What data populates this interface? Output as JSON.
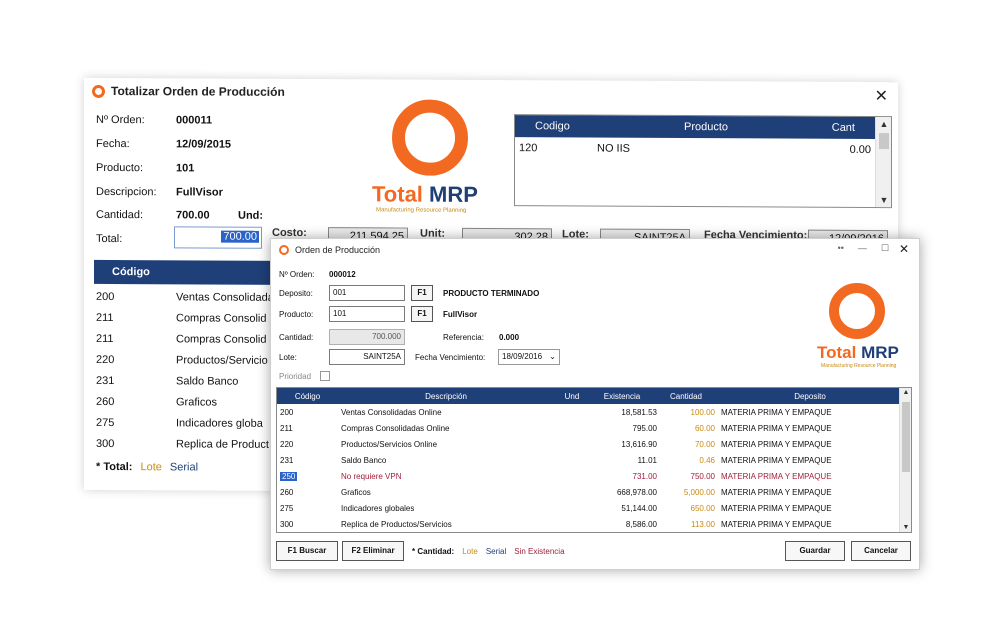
{
  "back_window": {
    "title": "Totalizar Orden de Producción",
    "close_glyph": "✕",
    "fields": {
      "orden_label": "Nº Orden:",
      "orden_value": "000011",
      "fecha_label": "Fecha:",
      "fecha_value": "12/09/2015",
      "producto_label": "Producto:",
      "producto_value": "101",
      "descripcion_label": "Descripcion:",
      "descripcion_value": "FullVisor",
      "cantidad_label": "Cantidad:",
      "cantidad_value": "700.00",
      "und_label": "Und:",
      "total_label": "Total:",
      "total_value": "700.00"
    },
    "strip": {
      "costo_label": "Costo:",
      "costo_value": "211,594.25",
      "unit_label": "Unit:",
      "unit_value": "302.28",
      "lote_label": "Lote:",
      "lote_value": "SAINT25A",
      "venc_label": "Fecha Vencimiento:",
      "venc_value": "12/09/2016"
    },
    "grid_header": {
      "codigo": "Código"
    },
    "rows": [
      {
        "code": "200",
        "desc": "Ventas Consolidadas"
      },
      {
        "code": "211",
        "desc": "Compras Consolid"
      },
      {
        "code": "211",
        "desc": "Compras Consolid"
      },
      {
        "code": "220",
        "desc": "Productos/Servicio"
      },
      {
        "code": "231",
        "desc": "Saldo Banco"
      },
      {
        "code": "260",
        "desc": "Graficos"
      },
      {
        "code": "275",
        "desc": "Indicadores globa"
      },
      {
        "code": "300",
        "desc": "Replica de Product"
      }
    ],
    "legend": {
      "label": "* Total:",
      "lote": "Lote",
      "serial": "Serial"
    },
    "mini_grid": {
      "headers": {
        "codigo": "Codigo",
        "producto": "Producto",
        "cant": "Cant"
      },
      "rows": [
        {
          "codigo": "120",
          "producto": "NO IIS",
          "cant": "0.00"
        }
      ]
    }
  },
  "logo": {
    "word1": "Total",
    "word2": " MRP",
    "tagline": "Manufacturing Resource Planning"
  },
  "front_window": {
    "title": "Orden de Producción",
    "close_glyph": "✕",
    "fields": {
      "orden_label": "Nº Orden:",
      "orden_value": "000012",
      "deposito_label": "Deposito:",
      "deposito_value": "001",
      "deposito_f1": "F1",
      "deposito_name": "PRODUCTO TERMINADO",
      "producto_label": "Producto:",
      "producto_value": "101",
      "producto_f1": "F1",
      "producto_name": "FullVisor",
      "cantidad_label": "Cantidad:",
      "cantidad_value": "700.000",
      "referencia_label": "Referencia:",
      "referencia_value": "0.000",
      "lote_label": "Lote:",
      "lote_value": "SAINT25A",
      "venc_label": "Fecha Vencimiento:",
      "venc_value": "18/09/2016",
      "prioridad_label": "Prioridad"
    },
    "grid_headers": {
      "codigo": "Código",
      "descripcion": "Descripción",
      "und": "Und",
      "existencia": "Existencia",
      "cantidad": "Cantidad",
      "deposito": "Deposito"
    },
    "rows": [
      {
        "code": "200",
        "desc": "Ventas Consolidadas Online",
        "exist": "18,581.53",
        "cant": "100.00",
        "dep": "MATERIA PRIMA Y EMPAQUE"
      },
      {
        "code": "211",
        "desc": "Compras Consolidadas Online",
        "exist": "795.00",
        "cant": "60.00",
        "dep": "MATERIA PRIMA Y EMPAQUE"
      },
      {
        "code": "220",
        "desc": "Productos/Servicios Online",
        "exist": "13,616.90",
        "cant": "70.00",
        "dep": "MATERIA PRIMA Y EMPAQUE"
      },
      {
        "code": "231",
        "desc": "Saldo Banco",
        "exist": "11.01",
        "cant": "0.46",
        "dep": "MATERIA PRIMA Y EMPAQUE"
      },
      {
        "code": "250",
        "desc": "No requiere VPN",
        "exist": "731.00",
        "cant": "750.00",
        "dep": "MATERIA PRIMA Y EMPAQUE"
      },
      {
        "code": "260",
        "desc": "Graficos",
        "exist": "668,978.00",
        "cant": "5,000.00",
        "dep": "MATERIA PRIMA Y EMPAQUE"
      },
      {
        "code": "275",
        "desc": "Indicadores globales",
        "exist": "51,144.00",
        "cant": "650.00",
        "dep": "MATERIA PRIMA Y EMPAQUE"
      },
      {
        "code": "300",
        "desc": "Replica de Productos/Servicios",
        "exist": "8,586.00",
        "cant": "113.00",
        "dep": "MATERIA PRIMA Y EMPAQUE"
      }
    ],
    "buttons": {
      "buscar": "F1 Buscar",
      "eliminar": "F2 Eliminar",
      "guardar": "Guardar",
      "cancelar": "Cancelar"
    },
    "legend": {
      "label": "* Cantidad:",
      "lote": "Lote",
      "serial": "Serial",
      "sin": "Sin Existencia"
    }
  },
  "colors": {
    "accent": "#f26a21",
    "header": "#1f3f78",
    "lote": "#c98a10",
    "alert": "#a0213b"
  }
}
